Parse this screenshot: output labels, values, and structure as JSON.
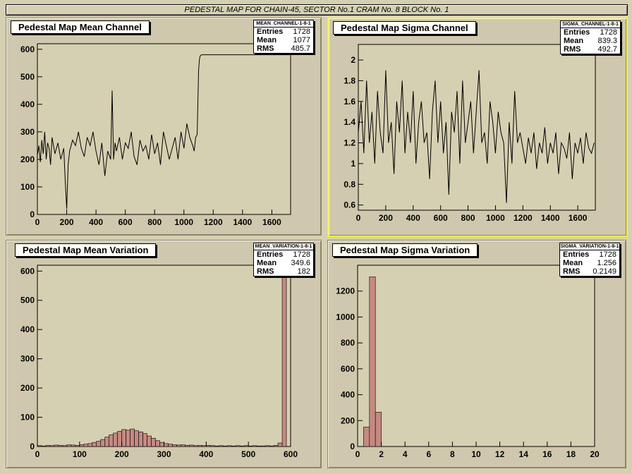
{
  "banner": "PEDESTAL MAP FOR CHAIN-45, SECTOR No.1 CRAM No. 8 BLOCK No. 1",
  "colors": {
    "canvas": "#d6d0b2",
    "frame": "#d6d0b2",
    "hist_fill": "#c48a82",
    "selected_pad": "#f2ef3a"
  },
  "pads": [
    {
      "title": "Pedestal Map Mean Channel",
      "stats": {
        "name": "MEAN_CHANNEL-1-8-1",
        "entries_label": "Entries",
        "entries": "1728",
        "mean_label": "Mean",
        "mean": "1077",
        "rms_label": "RMS",
        "rms": "485.7"
      }
    },
    {
      "title": "Pedestal Map Sigma Channel",
      "stats": {
        "name": "SIGMA_CHANNEL-1-8-1",
        "entries_label": "Entries",
        "entries": "1728",
        "mean_label": "Mean",
        "mean": "839.3",
        "rms_label": "RMS",
        "rms": "492.7"
      }
    },
    {
      "title": "Pedestal Map Mean Variation",
      "stats": {
        "name": "MEAN_VARIATION-1-8-1",
        "entries_label": "Entries",
        "entries": "1728",
        "mean_label": "Mean",
        "mean": "349.6",
        "rms_label": "RMS",
        "rms": "182"
      }
    },
    {
      "title": "Pedestal Map Sigma Variation",
      "stats": {
        "name": "SIGMA_VARIATION-1-8-1",
        "entries_label": "Entries",
        "entries": "1728",
        "mean_label": "Mean",
        "mean": "1.256",
        "rms_label": "RMS",
        "rms": "0.2149"
      }
    }
  ],
  "chart_data": [
    {
      "type": "line",
      "title": "Pedestal Map Mean Channel",
      "xlim": [
        0,
        1728
      ],
      "ylim": [
        0,
        620
      ],
      "xticks": [
        0,
        200,
        400,
        600,
        800,
        1000,
        1200,
        1400,
        1600
      ],
      "yticks": [
        0,
        100,
        200,
        300,
        400,
        500,
        600
      ],
      "x": [
        0,
        10,
        20,
        30,
        40,
        50,
        60,
        70,
        80,
        90,
        100,
        120,
        140,
        160,
        180,
        190,
        200,
        210,
        220,
        240,
        260,
        280,
        300,
        320,
        340,
        360,
        380,
        400,
        420,
        440,
        460,
        480,
        500,
        510,
        520,
        530,
        540,
        560,
        580,
        600,
        620,
        640,
        660,
        680,
        700,
        720,
        740,
        760,
        780,
        800,
        820,
        840,
        860,
        880,
        900,
        920,
        940,
        960,
        980,
        1000,
        1020,
        1040,
        1060,
        1070,
        1080,
        1090,
        1095,
        1100,
        1105,
        1110,
        1120,
        1140,
        1160,
        1180,
        1200,
        1720
      ],
      "y": [
        215,
        250,
        190,
        270,
        220,
        300,
        200,
        260,
        240,
        180,
        280,
        220,
        260,
        200,
        240,
        120,
        20,
        180,
        230,
        270,
        250,
        300,
        240,
        210,
        280,
        250,
        300,
        230,
        180,
        260,
        140,
        230,
        200,
        450,
        200,
        260,
        230,
        280,
        200,
        260,
        240,
        300,
        210,
        180,
        270,
        230,
        250,
        200,
        290,
        220,
        260,
        180,
        300,
        250,
        200,
        240,
        280,
        200,
        300,
        240,
        330,
        280,
        250,
        230,
        280,
        290,
        400,
        520,
        560,
        575,
        580,
        580,
        580,
        580,
        580,
        580
      ]
    },
    {
      "type": "line",
      "title": "Pedestal Map Sigma Channel",
      "xlim": [
        0,
        1728
      ],
      "ylim": [
        0.55,
        2.15
      ],
      "xticks": [
        0,
        200,
        400,
        600,
        800,
        1000,
        1200,
        1400,
        1600
      ],
      "yticks": [
        0.6,
        0.8,
        1,
        1.2,
        1.4,
        1.6,
        1.8,
        2
      ],
      "x": [
        0,
        20,
        40,
        60,
        80,
        100,
        120,
        140,
        160,
        180,
        200,
        220,
        240,
        260,
        280,
        300,
        320,
        340,
        360,
        380,
        400,
        420,
        440,
        460,
        480,
        500,
        520,
        540,
        560,
        580,
        600,
        620,
        640,
        660,
        680,
        700,
        720,
        740,
        760,
        780,
        800,
        820,
        840,
        860,
        880,
        900,
        920,
        940,
        960,
        980,
        1000,
        1020,
        1040,
        1060,
        1080,
        1100,
        1120,
        1140,
        1160,
        1180,
        1200,
        1220,
        1240,
        1260,
        1280,
        1300,
        1320,
        1340,
        1360,
        1380,
        1400,
        1420,
        1440,
        1460,
        1480,
        1500,
        1520,
        1540,
        1560,
        1580,
        1600,
        1620,
        1640,
        1660,
        1680,
        1700,
        1720
      ],
      "y": [
        1.3,
        1.6,
        1.1,
        1.8,
        1.2,
        1.5,
        1.0,
        1.7,
        1.3,
        1.1,
        1.9,
        1.2,
        1.4,
        0.9,
        1.6,
        1.3,
        1.8,
        1.1,
        1.5,
        1.2,
        1.7,
        1.0,
        1.4,
        1.6,
        1.2,
        1.3,
        0.85,
        1.5,
        1.8,
        1.2,
        1.6,
        1.1,
        1.4,
        0.7,
        1.5,
        1.3,
        1.7,
        1.0,
        1.8,
        1.2,
        1.4,
        1.6,
        1.1,
        1.5,
        1.9,
        1.2,
        1.3,
        1.0,
        1.6,
        1.4,
        1.1,
        1.5,
        1.3,
        1.2,
        0.62,
        1.4,
        1.0,
        1.7,
        1.2,
        1.3,
        1.15,
        1.0,
        1.25,
        1.1,
        1.3,
        0.95,
        1.2,
        1.1,
        1.35,
        1.0,
        1.2,
        1.1,
        1.3,
        0.9,
        1.2,
        1.15,
        1.05,
        1.3,
        0.85,
        1.2,
        1.1,
        1.25,
        1.0,
        1.3,
        1.15,
        1.1,
        1.2
      ]
    },
    {
      "type": "bar",
      "title": "Pedestal Map Mean Variation",
      "xlim": [
        0,
        600
      ],
      "ylim": [
        0,
        620
      ],
      "xticks": [
        0,
        100,
        200,
        300,
        400,
        500,
        600
      ],
      "yticks": [
        0,
        100,
        200,
        300,
        400,
        500,
        600
      ],
      "bins": [
        [
          0,
          10,
          3
        ],
        [
          10,
          20,
          2
        ],
        [
          20,
          30,
          4
        ],
        [
          30,
          40,
          3
        ],
        [
          40,
          50,
          5
        ],
        [
          50,
          60,
          4
        ],
        [
          60,
          70,
          3
        ],
        [
          70,
          80,
          6
        ],
        [
          80,
          90,
          5
        ],
        [
          90,
          100,
          4
        ],
        [
          100,
          110,
          6
        ],
        [
          110,
          120,
          8
        ],
        [
          120,
          130,
          10
        ],
        [
          130,
          140,
          14
        ],
        [
          140,
          150,
          18
        ],
        [
          150,
          160,
          24
        ],
        [
          160,
          170,
          32
        ],
        [
          170,
          180,
          40
        ],
        [
          180,
          190,
          46
        ],
        [
          190,
          200,
          52
        ],
        [
          200,
          210,
          58
        ],
        [
          210,
          220,
          56
        ],
        [
          220,
          230,
          60
        ],
        [
          230,
          240,
          54
        ],
        [
          240,
          250,
          50
        ],
        [
          250,
          260,
          44
        ],
        [
          260,
          270,
          36
        ],
        [
          270,
          280,
          28
        ],
        [
          280,
          290,
          20
        ],
        [
          290,
          300,
          14
        ],
        [
          300,
          310,
          10
        ],
        [
          310,
          320,
          8
        ],
        [
          320,
          330,
          6
        ],
        [
          330,
          340,
          5
        ],
        [
          340,
          350,
          6
        ],
        [
          350,
          360,
          4
        ],
        [
          360,
          370,
          5
        ],
        [
          370,
          380,
          3
        ],
        [
          380,
          390,
          4
        ],
        [
          390,
          400,
          3
        ],
        [
          400,
          410,
          4
        ],
        [
          410,
          420,
          3
        ],
        [
          420,
          430,
          2
        ],
        [
          430,
          440,
          3
        ],
        [
          440,
          450,
          2
        ],
        [
          450,
          460,
          3
        ],
        [
          460,
          470,
          2
        ],
        [
          470,
          480,
          3
        ],
        [
          480,
          490,
          2
        ],
        [
          490,
          500,
          3
        ],
        [
          500,
          510,
          2
        ],
        [
          510,
          520,
          3
        ],
        [
          520,
          530,
          2
        ],
        [
          530,
          540,
          2
        ],
        [
          540,
          550,
          3
        ],
        [
          550,
          560,
          2
        ],
        [
          560,
          570,
          4
        ],
        [
          570,
          580,
          12
        ],
        [
          580,
          590,
          580
        ]
      ]
    },
    {
      "type": "bar",
      "title": "Pedestal Map Sigma Variation",
      "xlim": [
        0,
        20
      ],
      "ylim": [
        0,
        1400
      ],
      "xticks": [
        0,
        2,
        4,
        6,
        8,
        10,
        12,
        14,
        16,
        18,
        20
      ],
      "yticks": [
        0,
        200,
        400,
        600,
        800,
        1000,
        1200
      ],
      "bins": [
        [
          0.5,
          1.0,
          150
        ],
        [
          1.0,
          1.5,
          1310
        ],
        [
          1.5,
          2.0,
          265
        ]
      ]
    }
  ]
}
